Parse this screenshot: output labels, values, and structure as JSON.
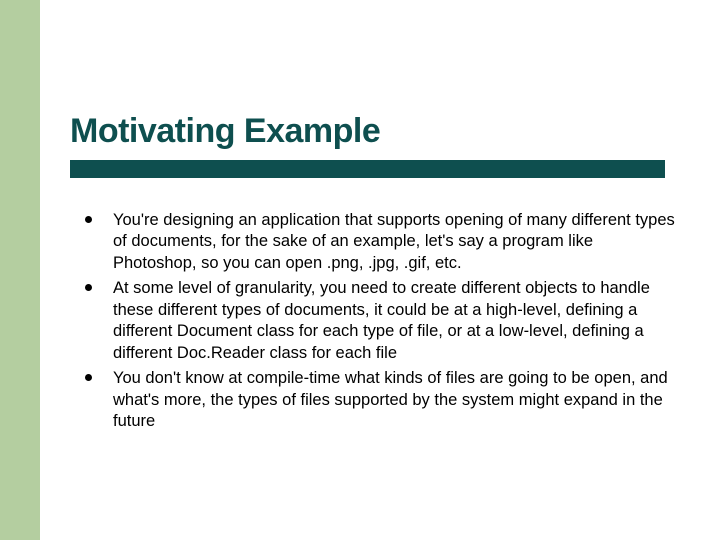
{
  "slide": {
    "title": "Motivating Example",
    "bullets": [
      "You're designing an application that supports opening of many different types of documents, for the sake of an example, let's say a program like Photoshop, so you can open .png, .jpg, .gif, etc.",
      "At some level of granularity, you need to create different objects to handle these different types of documents, it could be at a high-level, defining a different Document class for each type of file, or at a low-level, defining a different Doc.Reader class for each file",
      "You don't know at compile-time what kinds of files are going to be open, and what's more, the types of files supported by the system might expand in the future"
    ]
  },
  "colors": {
    "sidebar": "#b4cea0",
    "accent": "#0e4f4f"
  }
}
